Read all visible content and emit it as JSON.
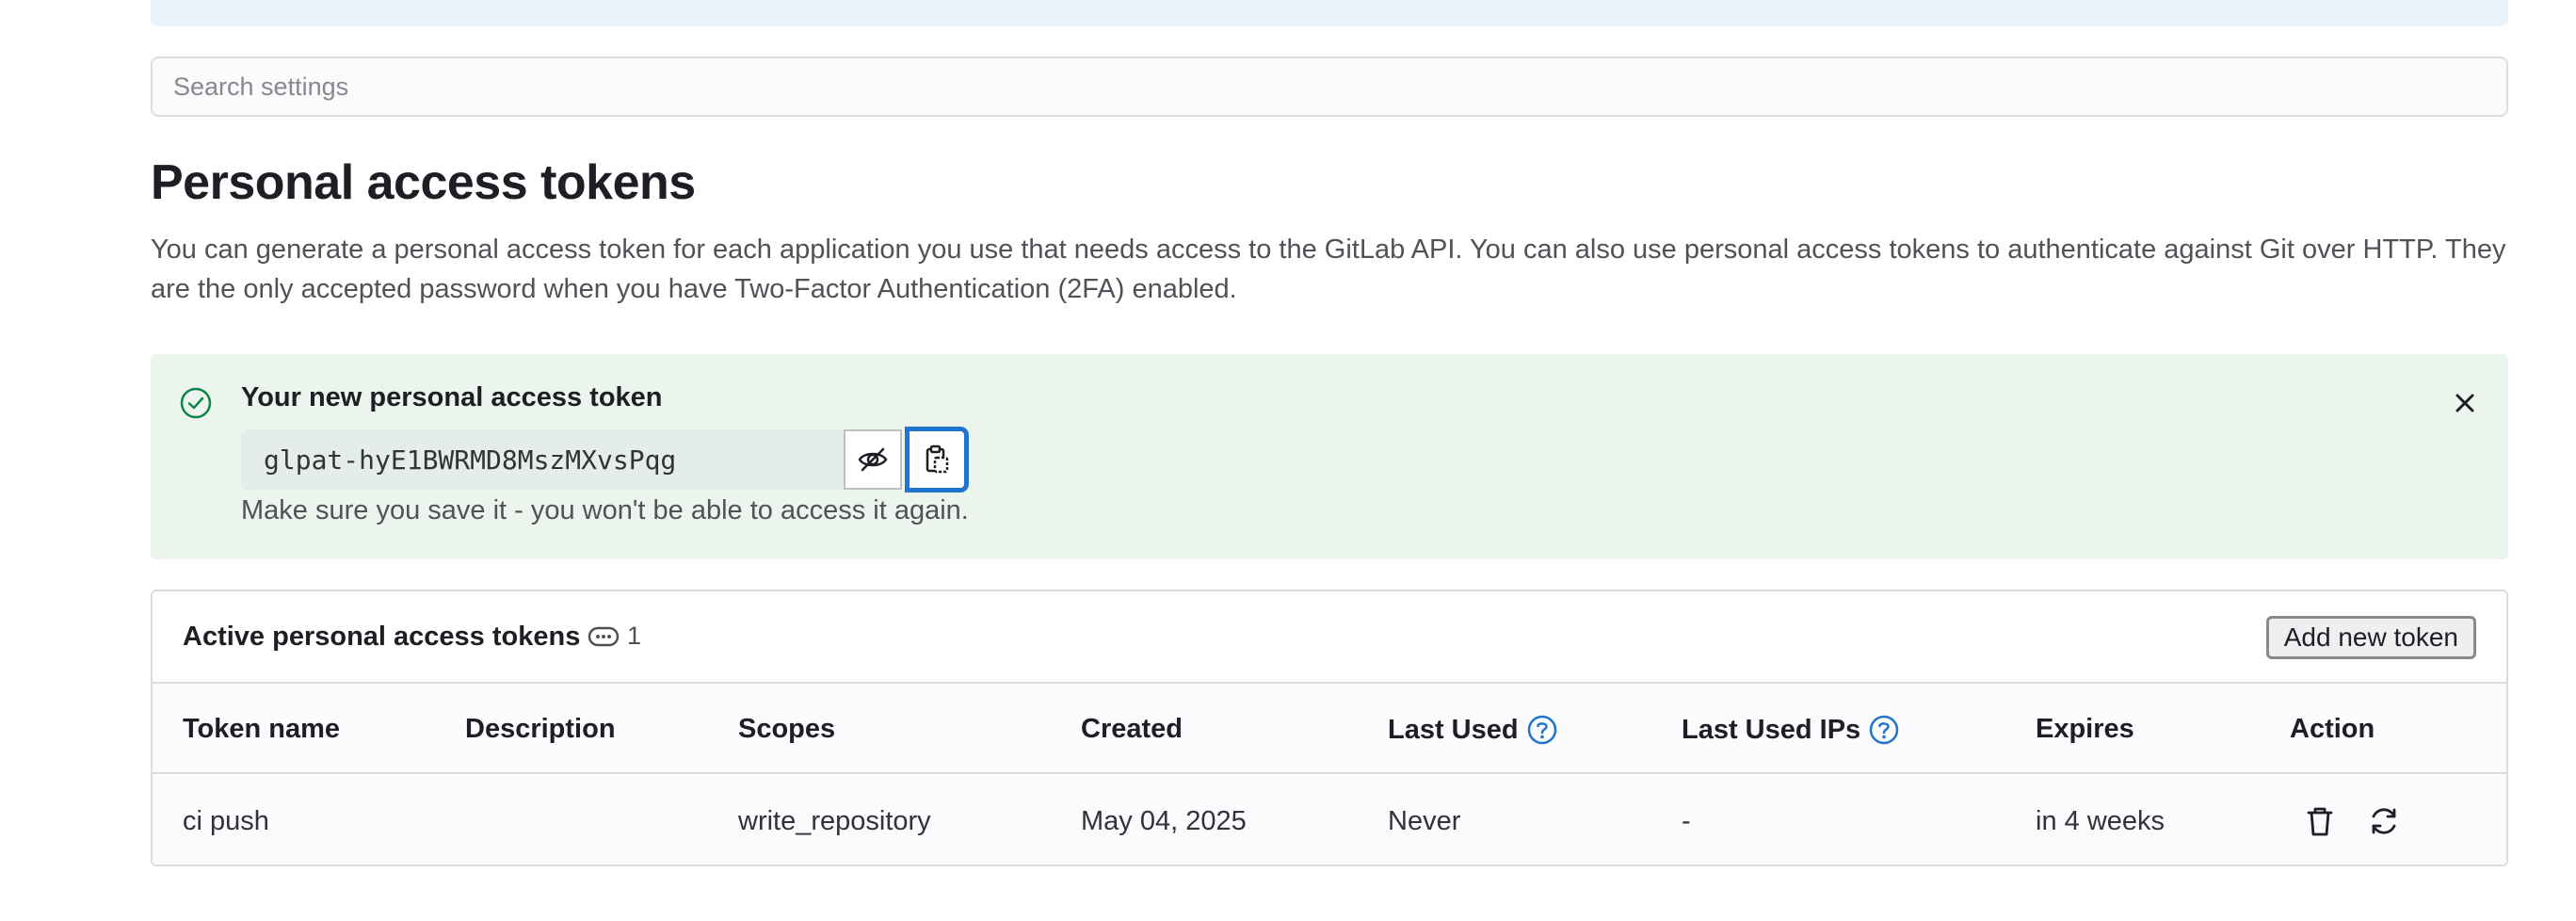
{
  "search": {
    "placeholder": "Search settings"
  },
  "header": {
    "title": "Personal access tokens",
    "description": "You can generate a personal access token for each application you use that needs access to the GitLab API. You can also use personal access tokens to authenticate against Git over HTTP. They are the only accepted password when you have Two-Factor Authentication (2FA) enabled."
  },
  "new_token_alert": {
    "title": "Your new personal access token",
    "token_value": "glpat-hyE1BWRMD8MszMXvsPqg",
    "note": "Make sure you save it - you won't be able to access it again.",
    "icons": [
      "check-circle-icon",
      "eye-slash-icon",
      "copy-clipboard-icon",
      "close-icon"
    ],
    "colors": {
      "background": "#ecf4ee",
      "success": "#108548"
    }
  },
  "tokens_table": {
    "title": "Active personal access tokens",
    "count": "1",
    "add_button_label": "Add new token",
    "columns": [
      "Token name",
      "Description",
      "Scopes",
      "Created",
      "Last Used",
      "Last Used IPs",
      "Expires",
      "Action"
    ],
    "rows": [
      {
        "token_name": "ci push",
        "description": "",
        "scopes": "write_repository",
        "created": "May 04, 2025",
        "last_used": "Never",
        "last_used_ips": "-",
        "expires": "in 4 weeks",
        "actions": [
          "trash-icon",
          "rotate-icon"
        ]
      }
    ]
  },
  "colors": {
    "accent": "#1f75cb",
    "help_icon": "#1f75cb"
  }
}
